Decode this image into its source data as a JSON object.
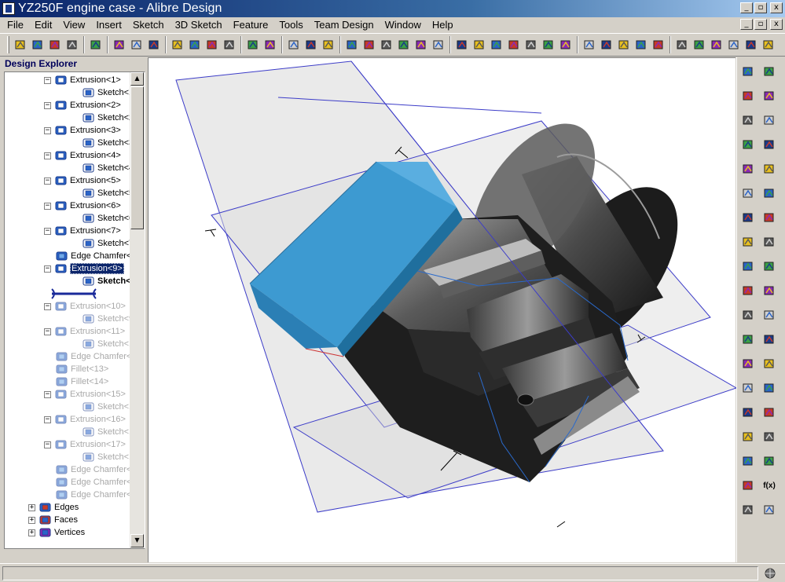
{
  "window": {
    "title": "YZ250F engine case - Alibre Design",
    "minimize": "_",
    "maximize": "▫",
    "close": "x"
  },
  "menu": [
    "File",
    "Edit",
    "View",
    "Insert",
    "Sketch",
    "3D Sketch",
    "Feature",
    "Tools",
    "Team Design",
    "Window",
    "Help"
  ],
  "toolbar": {
    "icons": [
      "new-document-icon",
      "open-folder-icon",
      "save-icon",
      "copy-part-icon",
      "paste-part-icon",
      "print-icon",
      "print-preview-icon",
      "pdf-export-icon",
      "cut-icon",
      "copy-icon",
      "paste-icon",
      "delete-icon",
      "undo-icon",
      "redo-icon",
      "sketch-icon",
      "circle-sketch-icon",
      "bracket-sketch-icon",
      "plane-icon",
      "axis-icon",
      "point-icon",
      "scissors-part-icon",
      "properties-list-icon",
      "layer-icon",
      "view-iso-icon",
      "view-front-icon",
      "view-back-icon",
      "view-left-icon",
      "view-right-icon",
      "view-top-icon",
      "view-bottom-icon",
      "shading-icon",
      "hidden-lines-icon",
      "display-mode-icon",
      "measure-icon",
      "inspect-icon",
      "select-icon",
      "zoom-window-icon",
      "rotate-icon",
      "zoom-icon",
      "zoom-all-icon",
      "zoom-fit-icon"
    ]
  },
  "design_explorer": {
    "title": "Design Explorer",
    "scroll_up": "▲",
    "scroll_down": "▼",
    "items": [
      {
        "label": "Extrusion<1>",
        "type": "extrusion",
        "level": 1,
        "expander": "−",
        "state": "normal"
      },
      {
        "label": "Sketch<1>",
        "type": "sketch",
        "level": 2,
        "expander": "",
        "state": "normal"
      },
      {
        "label": "Extrusion<2>",
        "type": "extrusion",
        "level": 1,
        "expander": "−",
        "state": "normal"
      },
      {
        "label": "Sketch<2>",
        "type": "sketch",
        "level": 2,
        "expander": "",
        "state": "normal"
      },
      {
        "label": "Extrusion<3>",
        "type": "extrusion",
        "level": 1,
        "expander": "−",
        "state": "normal"
      },
      {
        "label": "Sketch<3>",
        "type": "sketch",
        "level": 2,
        "expander": "",
        "state": "normal"
      },
      {
        "label": "Extrusion<4>",
        "type": "extrusion",
        "level": 1,
        "expander": "−",
        "state": "normal"
      },
      {
        "label": "Sketch<4>",
        "type": "sketch",
        "level": 2,
        "expander": "",
        "state": "normal"
      },
      {
        "label": "Extrusion<5>",
        "type": "extrusion",
        "level": 1,
        "expander": "−",
        "state": "normal"
      },
      {
        "label": "Sketch<5>",
        "type": "sketch",
        "level": 2,
        "expander": "",
        "state": "normal"
      },
      {
        "label": "Extrusion<6>",
        "type": "extrusion",
        "level": 1,
        "expander": "−",
        "state": "normal"
      },
      {
        "label": "Sketch<6>",
        "type": "sketch",
        "level": 2,
        "expander": "",
        "state": "normal"
      },
      {
        "label": "Extrusion<7>",
        "type": "extrusion",
        "level": 1,
        "expander": "−",
        "state": "normal"
      },
      {
        "label": "Sketch<7>",
        "type": "sketch",
        "level": 2,
        "expander": "",
        "state": "normal"
      },
      {
        "label": "Edge Chamfer<",
        "type": "chamfer",
        "level": 1,
        "expander": "",
        "state": "normal"
      },
      {
        "label": "Extrusion<9>",
        "type": "extrusion",
        "level": 1,
        "expander": "−",
        "state": "selected"
      },
      {
        "label": "Sketch<8",
        "type": "sketch",
        "level": 2,
        "expander": "",
        "state": "bold"
      },
      {
        "label": "",
        "type": "rollback",
        "level": 0,
        "expander": "",
        "state": "rollback"
      },
      {
        "label": "Extrusion<10>",
        "type": "extrusion",
        "level": 1,
        "expander": "−",
        "state": "dim"
      },
      {
        "label": "Sketch<9>",
        "type": "sketch",
        "level": 2,
        "expander": "",
        "state": "dim"
      },
      {
        "label": "Extrusion<11>",
        "type": "extrusion",
        "level": 1,
        "expander": "−",
        "state": "dim"
      },
      {
        "label": "Sketch<10:",
        "type": "sketch",
        "level": 2,
        "expander": "",
        "state": "dim"
      },
      {
        "label": "Edge Chamfer<",
        "type": "chamfer",
        "level": 1,
        "expander": "",
        "state": "dim"
      },
      {
        "label": "Fillet<13>",
        "type": "chamfer",
        "level": 1,
        "expander": "",
        "state": "dim"
      },
      {
        "label": "Fillet<14>",
        "type": "chamfer",
        "level": 1,
        "expander": "",
        "state": "dim"
      },
      {
        "label": "Extrusion<15>",
        "type": "extrusion",
        "level": 1,
        "expander": "−",
        "state": "dim"
      },
      {
        "label": "Sketch<11:",
        "type": "sketch",
        "level": 2,
        "expander": "",
        "state": "dim"
      },
      {
        "label": "Extrusion<16>",
        "type": "extrusion",
        "level": 1,
        "expander": "−",
        "state": "dim"
      },
      {
        "label": "Sketch<12:",
        "type": "sketch",
        "level": 2,
        "expander": "",
        "state": "dim"
      },
      {
        "label": "Extrusion<17>",
        "type": "extrusion",
        "level": 1,
        "expander": "−",
        "state": "dim"
      },
      {
        "label": "Sketch<13:",
        "type": "sketch",
        "level": 2,
        "expander": "",
        "state": "dim"
      },
      {
        "label": "Edge Chamfer<",
        "type": "chamfer",
        "level": 1,
        "expander": "",
        "state": "dim"
      },
      {
        "label": "Edge Chamfer<",
        "type": "chamfer",
        "level": 1,
        "expander": "",
        "state": "dim"
      },
      {
        "label": "Edge Chamfer<",
        "type": "chamfer",
        "level": 1,
        "expander": "",
        "state": "dim"
      },
      {
        "label": "Edges",
        "type": "edges",
        "level": 0,
        "expander": "+",
        "state": "normal"
      },
      {
        "label": "Faces",
        "type": "faces",
        "level": 0,
        "expander": "+",
        "state": "normal"
      },
      {
        "label": "Vertices",
        "type": "vertices",
        "level": 0,
        "expander": "+",
        "state": "normal"
      }
    ]
  },
  "right_toolbar_1": [
    "sketch-activate-icon",
    "point-icon",
    "construction-line-icon",
    "arc-icon",
    "line-icon",
    "circle-icon",
    "tangent-arc-icon",
    "rectangle-icon",
    "spline-icon",
    "sketch-point-icon",
    "dimension-icon",
    "trim-icon",
    "extend-icon",
    "fillet-sketch-icon",
    "chamfer-sketch-icon",
    "project-icon",
    "offset-icon",
    "mirror-icon",
    "constraint-icon"
  ],
  "right_toolbar_2": [
    "extrude-boss-icon",
    "extrude-cut-icon",
    "revolve-icon",
    "revolve-cut-icon",
    "loft-icon",
    "sweep-icon",
    "shell-icon",
    "fillet-icon",
    "chamfer-icon",
    "draft-icon",
    "scale-icon",
    "split-icon",
    "hole-icon",
    "pattern-icon",
    "mirror-feature-icon",
    "thread-icon",
    "cosmetic-icon",
    "equation-icon",
    "constraint-feature-icon"
  ],
  "labels": {
    "equation": "f(x)"
  },
  "colors": {
    "selected_face": "#3d9ad1",
    "part_body": "#1e1e1e",
    "plane_fill": "#d9d9d9",
    "plane_edge": "#3c3cc8",
    "selection_highlight": "#0a246a"
  },
  "statusbar": {
    "text": ""
  }
}
